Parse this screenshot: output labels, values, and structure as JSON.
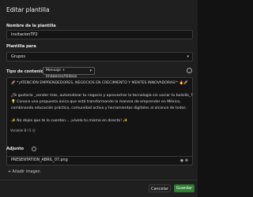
{
  "modal": {
    "title": "Editar plantilla"
  },
  "fields": {
    "name_label": "Nombre de la plantilla",
    "name_value": "InvitacionTP2",
    "plantilla_label": "Plantilla para",
    "plantilla_value": "Grupos",
    "tipo_label": "Tipo de contenido",
    "tipo_value": "Mensaje + Imágenes/Videos"
  },
  "message": {
    "line1": "🚀 *¡ATENCIÓN EMPRENDEDORES, NEGOCIOS EN CRECIMIENTO Y MENTES INNOVADORAS!* 🔥🚀",
    "line2": "¿Te gustaría _vender más, automatizar tu negocio y aprovechar la tecnología sin vaciar tu bolsillo_?",
    "line3": "💡 Conoce una propuesta única que está transformando la manera de emprender en México,",
    "line4": "combinando educación práctica, comunidad activa y herramientas digitales al alcance de todos.",
    "line5": "✨ No dejes que te lo cuenten… ¡vívelo tú mismo en directo! ✨",
    "format_bar": "Variable   B   I   S   ☺"
  },
  "attachment": {
    "label": "Adjunto",
    "file_name": "PRESENTATION_ABRIL_07.png",
    "add_label": "+ Añadir imagen"
  },
  "actions": {
    "cancel_label": "Cancelar",
    "save_label": "Guardar"
  },
  "colors": {
    "background": "#1f1f1f",
    "save_button": "#2e7d32"
  },
  "icons": {
    "help": "help-icon",
    "dropdown": "chevron-down-icon",
    "remove_file": "close-icon",
    "view_file": "eye-icon"
  }
}
